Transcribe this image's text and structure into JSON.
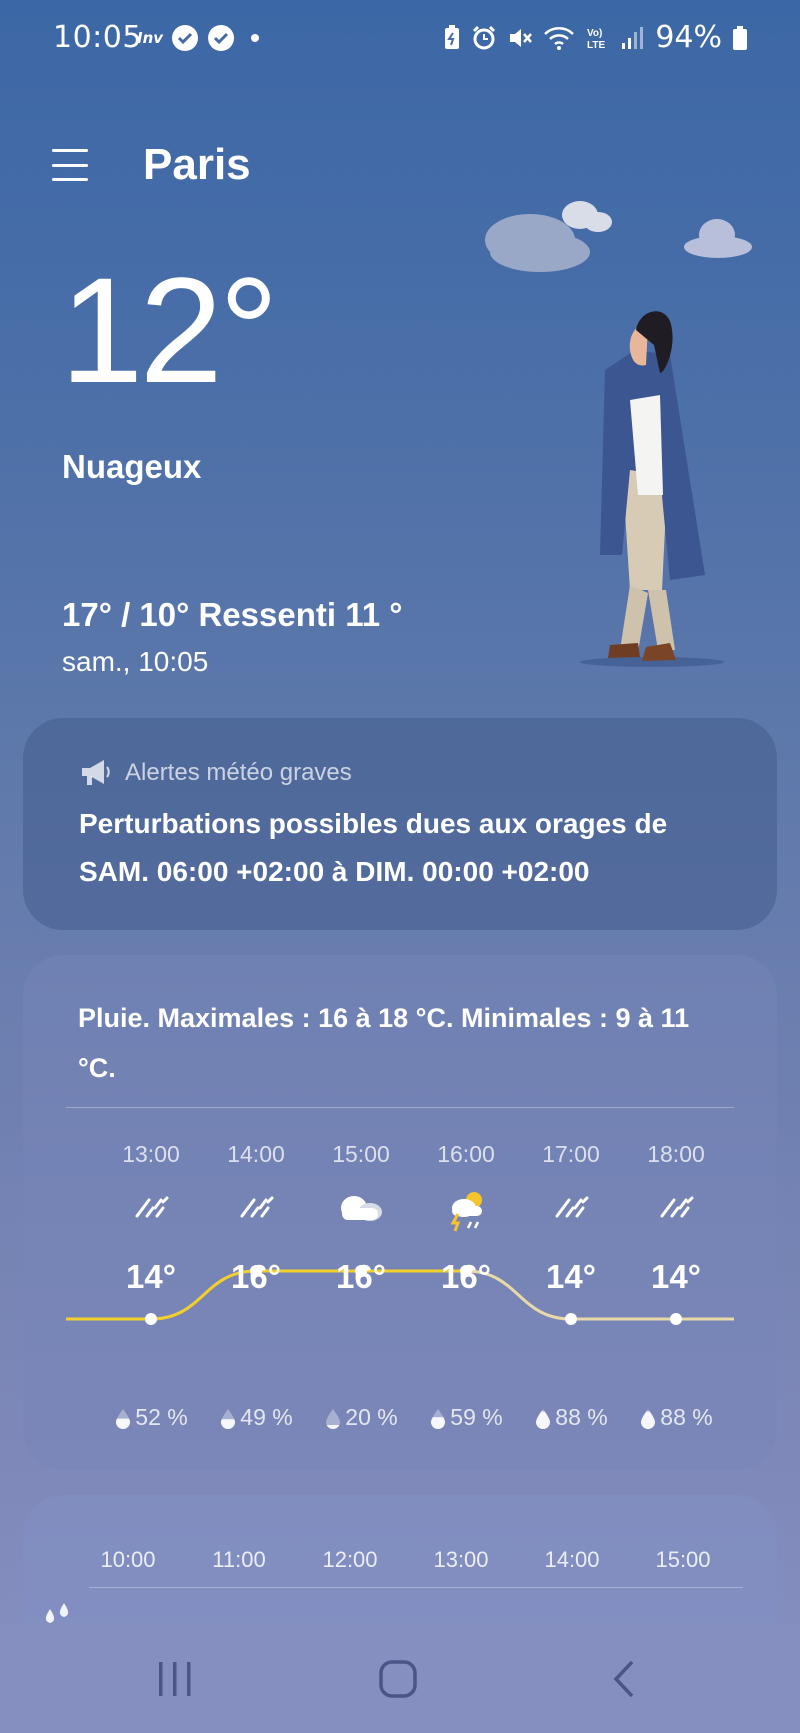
{
  "status_bar": {
    "time": "10:05",
    "left_icons": [
      "inv-icon",
      "check-circle-icon",
      "check-circle-icon",
      "dot-icon"
    ],
    "right_icons": [
      "battery-saver-icon",
      "alarm-icon",
      "mute-icon",
      "wifi-icon",
      "volte-icon",
      "signal-icon"
    ],
    "battery": "94%"
  },
  "header": {
    "city": "Paris"
  },
  "current": {
    "temperature": "12°",
    "condition": "Nuageux",
    "hilo_feels": "17° / 10° Ressenti 11 °",
    "datetime": "sam., 10:05"
  },
  "alert": {
    "header": "Alertes météo graves",
    "text": "Perturbations possibles dues aux orages de SAM. 06:00 +02:00 à DIM. 00:00 +02:00"
  },
  "forecast": {
    "summary": "Pluie. Maximales : 16 à 18 °C. Minimales : 9 à 11 °C.",
    "hours": [
      {
        "time": "13:00",
        "icon": "rain-icon",
        "temp": "14°",
        "temp_value": 14,
        "precip": "52 %"
      },
      {
        "time": "14:00",
        "icon": "rain-icon",
        "temp": "16°",
        "temp_value": 16,
        "precip": "49 %"
      },
      {
        "time": "15:00",
        "icon": "cloudy-icon",
        "temp": "16°",
        "temp_value": 16,
        "precip": "20 %"
      },
      {
        "time": "16:00",
        "icon": "thunderstorm-icon",
        "temp": "16°",
        "temp_value": 16,
        "precip": "59 %"
      },
      {
        "time": "17:00",
        "icon": "rain-icon",
        "temp": "14°",
        "temp_value": 14,
        "precip": "88 %"
      },
      {
        "time": "18:00",
        "icon": "rain-icon",
        "temp": "14°",
        "temp_value": 14,
        "precip": "88 %"
      }
    ]
  },
  "precipitation_card": {
    "hours": [
      "10:00",
      "11:00",
      "12:00",
      "13:00",
      "14:00",
      "15:00"
    ],
    "icon": "rain-drops-icon"
  },
  "nav": {
    "recents": "recents-icon",
    "home": "home-icon",
    "back": "back-icon"
  },
  "colors": {
    "curve_past": "#f2cf2a",
    "curve_future": "#e8d9a8",
    "accent": "#ffffff"
  }
}
